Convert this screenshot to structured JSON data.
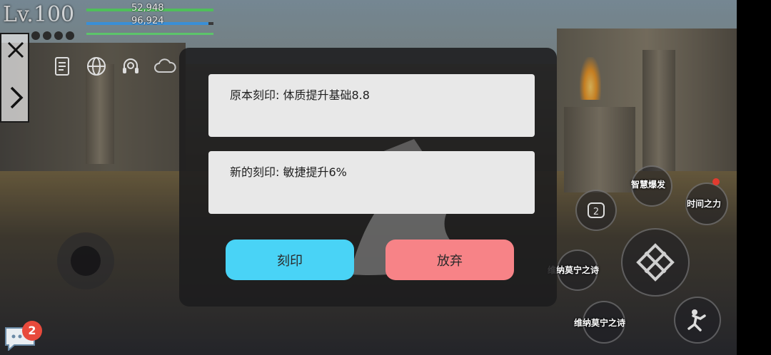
{
  "player": {
    "level_prefix": "Lv.",
    "level": "100",
    "hp": "52,948",
    "mp": "96,924"
  },
  "hud": {
    "icons": [
      "scroll-icon",
      "globe-icon",
      "headset-icon",
      "cloud-icon"
    ]
  },
  "dialog": {
    "original_engraving": "原本刻印: 体质提升基础8.8",
    "new_engraving": "新的刻印: 敏捷提升6%",
    "engrave_button": "刻印",
    "abandon_button": "放弃"
  },
  "skills": {
    "wisdom_burst": "智慧爆发",
    "time_power": "时间之力",
    "venna_poem_1": "维纳莫宁之诗",
    "venna_poem_2": "维纳莫宁之诗",
    "slot_number": "2"
  },
  "chat": {
    "badge_count": "2"
  },
  "colors": {
    "engrave_button": "#49d3f6",
    "abandon_button": "#f78387",
    "hp_bar": "#4fbf5a",
    "mp_bar": "#3a8fd6",
    "badge": "#e84a3c"
  }
}
